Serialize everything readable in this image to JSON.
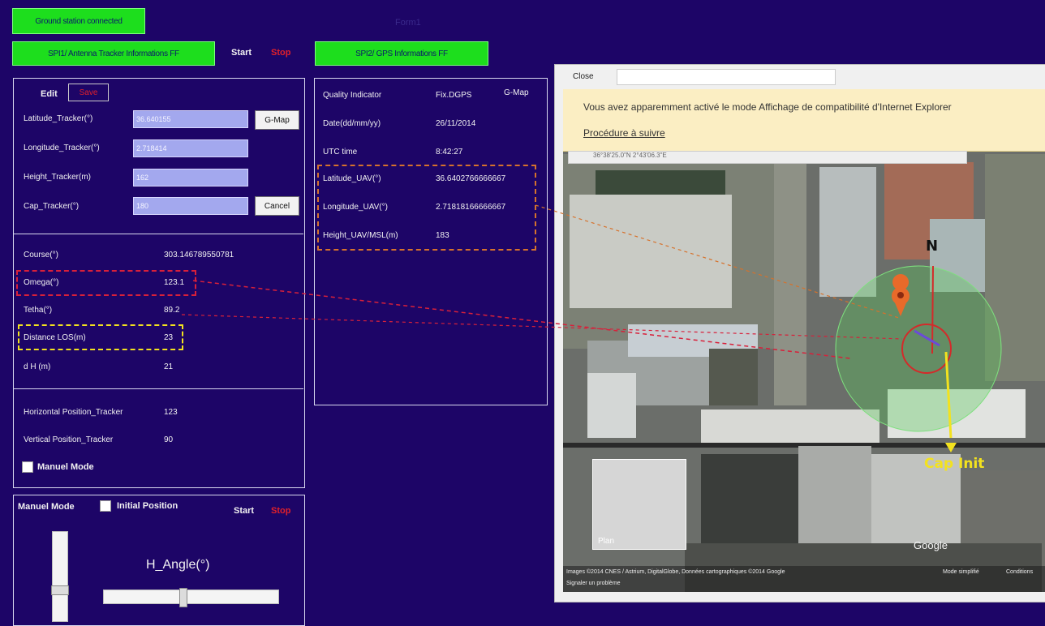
{
  "top": {
    "status": "Ground station connected",
    "window_title": "Form1",
    "spi1_button": "SPI1/ Antenna Tracker Informations FF",
    "start": "Start",
    "stop": "Stop",
    "spi2_button": "SPI2/ GPS Informations FF"
  },
  "tracker": {
    "edit": "Edit",
    "save": "Save",
    "gmap": "G-Map",
    "cancel": "Cancel",
    "fields": [
      {
        "label": "Latitude_Tracker(°)",
        "value": "36.640155"
      },
      {
        "label": "Longitude_Tracker(°)",
        "value": "2.718414"
      },
      {
        "label": "Height_Tracker(m)",
        "value": "162"
      },
      {
        "label": "Cap_Tracker(°)",
        "value": "180"
      }
    ],
    "readings": [
      {
        "label": "Course(°)",
        "value": "303.146789550781"
      },
      {
        "label": "Omega(°)",
        "value": "123.1"
      },
      {
        "label": "Tetha(°)",
        "value": "89.2"
      },
      {
        "label": "Distance LOS(m)",
        "value": "23"
      },
      {
        "label": "d H (m)",
        "value": "21"
      }
    ],
    "positions": [
      {
        "label": "Horizontal Position_Tracker",
        "value": "123"
      },
      {
        "label": "Vertical Position_Tracker",
        "value": "90"
      }
    ],
    "manual_mode": "Manuel Mode"
  },
  "manual_panel": {
    "title": "Manuel Mode",
    "initial_position": "Initial Position",
    "start": "Start",
    "stop": "Stop",
    "h_angle": "H_Angle(°)",
    "h_angle_level": 0.45
  },
  "gps": {
    "gmap": "G-Map",
    "rows": [
      {
        "label": "Quality Indicator",
        "value": "Fix.DGPS"
      },
      {
        "label": "Date(dd/mm/yy)",
        "value": "26/11/2014"
      },
      {
        "label": "UTC time",
        "value": "8:42:27"
      },
      {
        "label": "Latitude_UAV(°)",
        "value": "36.6402766666667"
      },
      {
        "label": "Longitude_UAV(°)",
        "value": "2.71818166666667"
      },
      {
        "label": "Height_UAV/MSL(m)",
        "value": "183"
      }
    ]
  },
  "browser": {
    "close": "Close",
    "ie_notice": "Vous avez apparemment activé le mode Affichage de compatibilité d'Internet Explorer",
    "procedure": "Procédure à suivre",
    "coords_partial": "36°38'25.0\"N 2°43'06.3\"E",
    "north": "N",
    "cap_init": "Cap Init",
    "plan": "Plan",
    "google": "Google",
    "attribution": "Images ©2014 CNES / Astrium, DigitalGlobe, Données cartographiques ©2014 Google",
    "mode": "Mode simplifié",
    "conditions": "Conditions",
    "report": "Signaler un problème"
  },
  "colors": {
    "background": "#1d0567",
    "green_button": "#1dde1d",
    "field_fill": "#a3a8ee",
    "stop_red": "#e0202a",
    "highlight_red": "#d8203a",
    "highlight_yellow": "#f3e21e",
    "highlight_orange": "#d6722c",
    "ie_bar": "#fbeec3"
  }
}
